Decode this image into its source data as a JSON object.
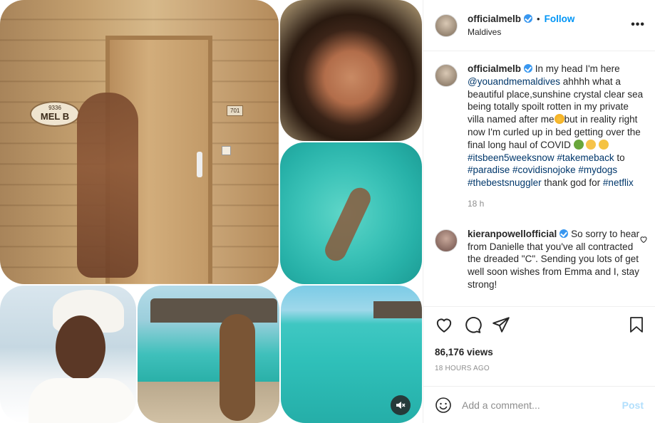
{
  "media": {
    "door_plate_number": "9336",
    "door_plate_name": "MEL B",
    "room_number": "701"
  },
  "header": {
    "username": "officialmelb",
    "separator": "•",
    "follow_label": "Follow",
    "location": "Maldives",
    "more_icon": "more-horizontal-icon"
  },
  "caption": {
    "username": "officialmelb",
    "text_1": "In my head I'm here",
    "mention": "@youandmemaldives",
    "text_2": "ahhhh what a beautiful place,sunshine crystal clear sea being totally spoilt rotten in my private villa named after me",
    "text_3": "but in reality right now I'm curled up in bed getting over the final long haul of COVID",
    "hashtags_1": "#itsbeen5weeksnow",
    "hashtags_2": "#takemeback",
    "to": "to",
    "hashtags_3": "#paradise #covidisnojoke #mydogs #thebestsnuggler",
    "text_4": "thank god for",
    "hashtag_last": "#netflix",
    "timestamp": "18 h"
  },
  "comment": {
    "username": "kieranpowellofficial",
    "text": "So sorry to hear from Danielle that you've all contracted the dreaded \"C\". Sending you lots of get well soon wishes from Emma and I, stay strong!"
  },
  "stats": {
    "views": "86,176 views",
    "posted": "18 HOURS AGO"
  },
  "add_comment": {
    "placeholder": "Add a comment...",
    "post_label": "Post"
  },
  "colors": {
    "accent": "#0095f6",
    "verified": "#3897f0",
    "link": "#00376b",
    "muted": "#8e8e8e"
  }
}
